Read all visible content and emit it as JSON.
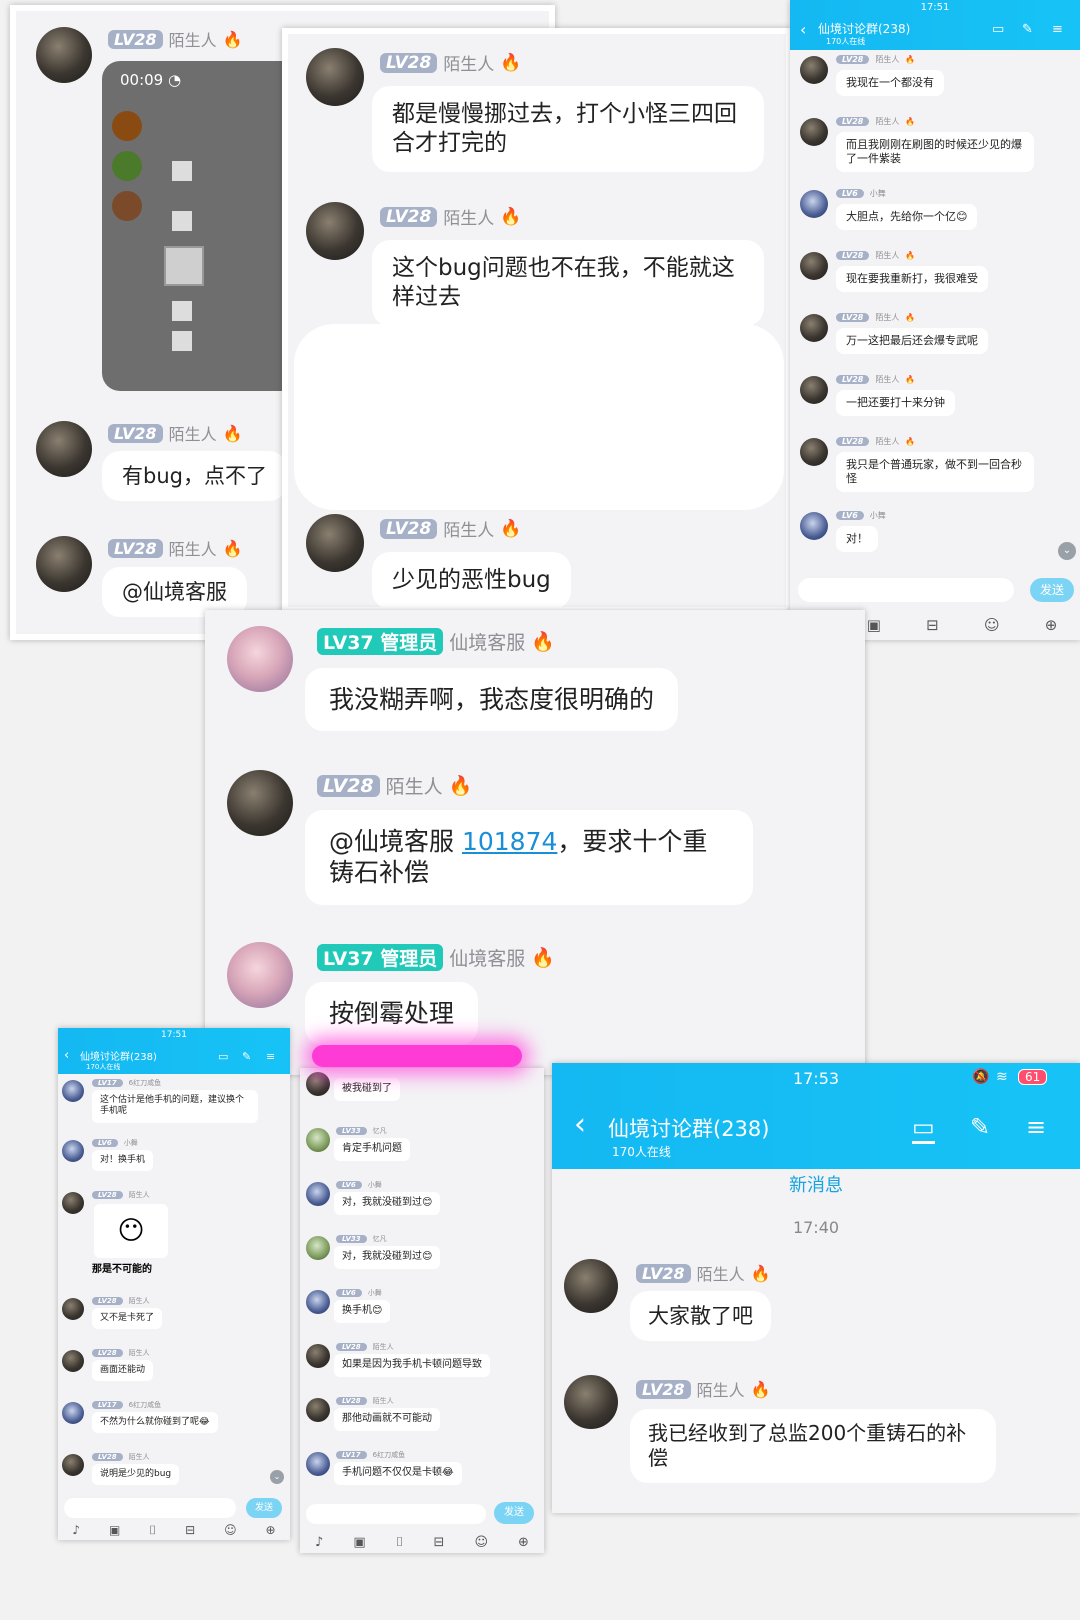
{
  "screenshot_1": {
    "video_time": "00:09",
    "messages": [
      {
        "level": "LV28",
        "name": "陌生人",
        "text": ""
      },
      {
        "level": "LV28",
        "name": "陌生人",
        "text": "有bug，点不了"
      },
      {
        "level": "LV28",
        "name": "陌生人",
        "text": "@仙境客服"
      }
    ]
  },
  "screenshot_2": {
    "messages": [
      {
        "level": "LV28",
        "name": "陌生人",
        "text": "都是慢慢挪过去，打个小怪三四回合才打完的"
      },
      {
        "level": "LV28",
        "name": "陌生人",
        "text": "这个bug问题也不在我，不能就这样过去"
      },
      {
        "level": "LV28",
        "name": "陌生人",
        "text": "少见的恶性bug"
      }
    ]
  },
  "screenshot_3": {
    "status_time": "17:51",
    "title": "仙境讨论群(238)",
    "online": "170人在线",
    "send": "发送",
    "messages": [
      {
        "level": "LV28",
        "name": "陌生人",
        "text": "我现在一个都没有"
      },
      {
        "level": "LV28",
        "name": "陌生人",
        "text": "而且我刚刚在刷图的时候还少见的爆了一件紫装"
      },
      {
        "level": "LV6",
        "name": "小舞",
        "text": "大胆点，先给你一个亿😊"
      },
      {
        "level": "LV28",
        "name": "陌生人",
        "text": "现在要我重新打，我很难受"
      },
      {
        "level": "LV28",
        "name": "陌生人",
        "text": "万一这把最后还会爆专武呢"
      },
      {
        "level": "LV28",
        "name": "陌生人",
        "text": "一把还要打十来分钟"
      },
      {
        "level": "LV28",
        "name": "陌生人",
        "text": "我只是个普通玩家，做不到一回合秒怪"
      },
      {
        "level": "LV6",
        "name": "小舞",
        "text": "对！"
      }
    ]
  },
  "screenshot_4": {
    "messages": [
      {
        "level": "LV37",
        "role": "管理员",
        "name": "仙境客服",
        "text": "我没糊弄啊，我态度很明确的"
      },
      {
        "level": "LV28",
        "name": "陌生人",
        "text_prefix": "@仙境客服 ",
        "link": "101874",
        "text_suffix": "，要求十个重铸石补偿"
      },
      {
        "level": "LV37",
        "role": "管理员",
        "name": "仙境客服",
        "text": "按倒霉处理"
      }
    ]
  },
  "screenshot_5": {
    "status_time": "17:51",
    "title": "仙境讨论群(238)",
    "online": "170人在线",
    "send": "发送",
    "messages": [
      {
        "level": "LV17",
        "name": "6红刀咸鱼",
        "text": "这个估计是他手机的问题，建议换个手机呢"
      },
      {
        "level": "LV6",
        "name": "小舞",
        "text": "对！换手机"
      },
      {
        "level": "LV28",
        "name": "陌生人",
        "text": "那是不可能的"
      },
      {
        "level": "LV28",
        "name": "陌生人",
        "text": "又不是卡死了"
      },
      {
        "level": "LV28",
        "name": "陌生人",
        "text": "画面还能动"
      },
      {
        "level": "LV17",
        "name": "6红刀咸鱼",
        "text": "不然为什么就你碰到了呢😂"
      },
      {
        "level": "LV28",
        "name": "陌生人",
        "text": "说明是少见的bug"
      }
    ]
  },
  "screenshot_6": {
    "send": "发送",
    "messages": [
      {
        "level": "",
        "name": "",
        "text": "被我碰到了"
      },
      {
        "level": "LV33",
        "name": "忆凡",
        "text": "肯定手机问题"
      },
      {
        "level": "LV6",
        "name": "小舞",
        "text": "对，我就没碰到过😊"
      },
      {
        "level": "LV33",
        "name": "忆凡",
        "text": "对，我就没碰到过😊"
      },
      {
        "level": "LV6",
        "name": "小舞",
        "text": "换手机😊"
      },
      {
        "level": "LV28",
        "name": "陌生人",
        "text": "如果是因为我手机卡顿问题导致"
      },
      {
        "level": "LV28",
        "name": "陌生人",
        "text": "那他动画就不可能动"
      },
      {
        "level": "LV17",
        "name": "6红刀咸鱼",
        "text": "手机问题不仅仅是卡顿😂"
      }
    ]
  },
  "screenshot_7": {
    "status_time": "17:53",
    "battery": "61",
    "title": "仙境讨论群(238)",
    "online": "170人在线",
    "new_messages": "新消息",
    "time_divider": "17:40",
    "messages": [
      {
        "level": "LV28",
        "name": "陌生人",
        "text": "大家散了吧"
      },
      {
        "level": "LV28",
        "name": "陌生人",
        "text": "我已经收到了总监200个重铸石的补偿"
      }
    ]
  },
  "colors": {
    "header": "#17c3f6",
    "level_badge": "#a6b1c8",
    "admin_badge": "#20c9b8",
    "fire": "#ff6a00",
    "link": "#1a8ed6",
    "highlight": "#ff3bd6"
  }
}
